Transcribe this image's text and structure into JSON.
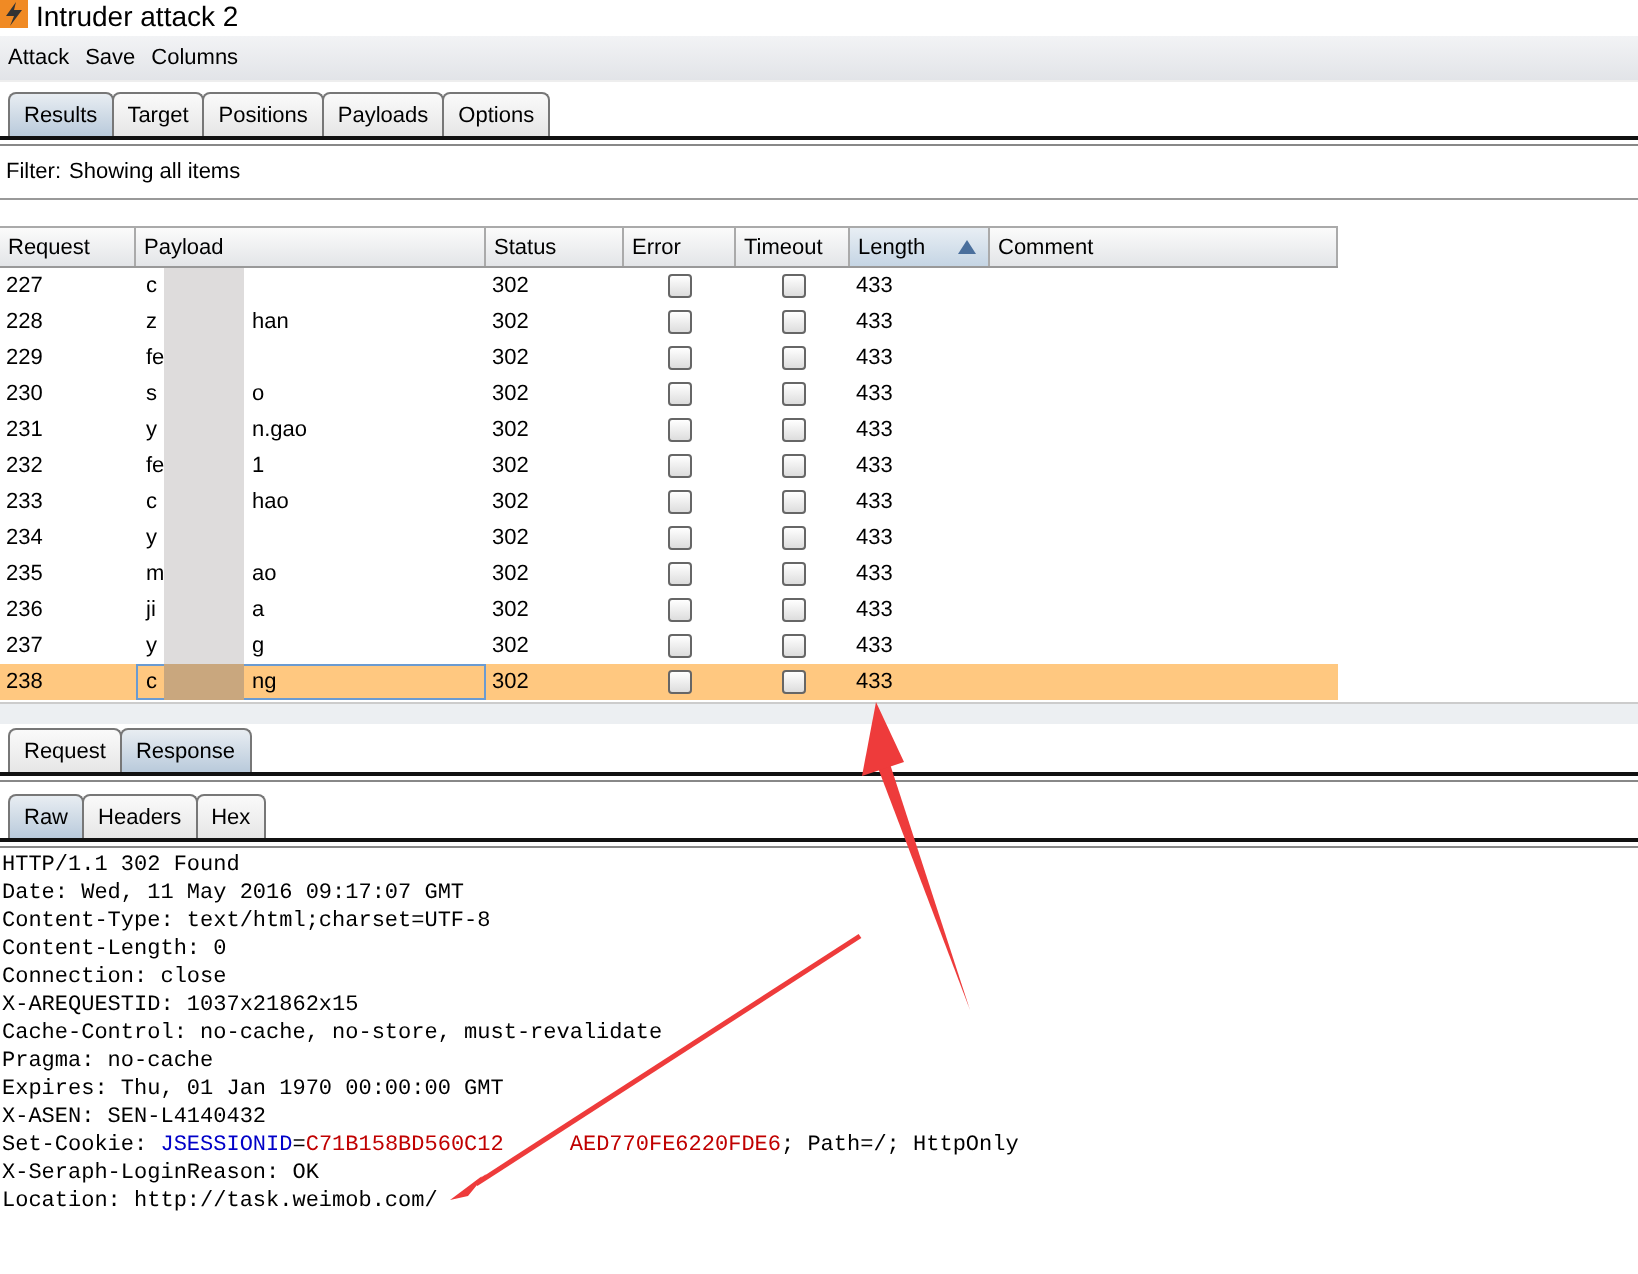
{
  "window": {
    "title": "Intruder attack 2"
  },
  "menu": [
    "Attack",
    "Save",
    "Columns"
  ],
  "tabs": [
    {
      "label": "Results",
      "selected": true
    },
    {
      "label": "Target",
      "selected": false
    },
    {
      "label": "Positions",
      "selected": false
    },
    {
      "label": "Payloads",
      "selected": false
    },
    {
      "label": "Options",
      "selected": false
    }
  ],
  "filter": {
    "label": "Filter:",
    "value": "Showing all items"
  },
  "table": {
    "columns": [
      {
        "label": "Request",
        "sorted": false
      },
      {
        "label": "Payload",
        "sorted": false
      },
      {
        "label": "Status",
        "sorted": false
      },
      {
        "label": "Error",
        "sorted": false
      },
      {
        "label": "Timeout",
        "sorted": false
      },
      {
        "label": "Length",
        "sorted": true
      },
      {
        "label": "Comment",
        "sorted": false
      }
    ],
    "rows": [
      {
        "request": "227",
        "payload_start": "c",
        "status": "302",
        "error": false,
        "timeout": false,
        "length": "433",
        "selected": false
      },
      {
        "request": "228",
        "payload_start": "z",
        "payload_end": "han",
        "status": "302",
        "error": false,
        "timeout": false,
        "length": "433",
        "selected": false
      },
      {
        "request": "229",
        "payload_start": "fe",
        "status": "302",
        "error": false,
        "timeout": false,
        "length": "433",
        "selected": false
      },
      {
        "request": "230",
        "payload_start": "s",
        "payload_end": "o",
        "status": "302",
        "error": false,
        "timeout": false,
        "length": "433",
        "selected": false
      },
      {
        "request": "231",
        "payload_start": "y",
        "payload_end": "n.gao",
        "status": "302",
        "error": false,
        "timeout": false,
        "length": "433",
        "selected": false
      },
      {
        "request": "232",
        "payload_start": "fe",
        "payload_end": "1",
        "status": "302",
        "error": false,
        "timeout": false,
        "length": "433",
        "selected": false
      },
      {
        "request": "233",
        "payload_start": "c",
        "payload_end": "hao",
        "status": "302",
        "error": false,
        "timeout": false,
        "length": "433",
        "selected": false
      },
      {
        "request": "234",
        "payload_start": "y",
        "status": "302",
        "error": false,
        "timeout": false,
        "length": "433",
        "selected": false
      },
      {
        "request": "235",
        "payload_start": "m",
        "payload_end": "ao",
        "status": "302",
        "error": false,
        "timeout": false,
        "length": "433",
        "selected": false
      },
      {
        "request": "236",
        "payload_start": "ji",
        "payload_end": "a",
        "status": "302",
        "error": false,
        "timeout": false,
        "length": "433",
        "selected": false
      },
      {
        "request": "237",
        "payload_start": "y",
        "payload_end": "g",
        "status": "302",
        "error": false,
        "timeout": false,
        "length": "433",
        "selected": false
      },
      {
        "request": "238",
        "payload_start": "c",
        "payload_end": "ng",
        "status": "302",
        "error": false,
        "timeout": false,
        "length": "433",
        "selected": true
      }
    ]
  },
  "message_tabs": [
    {
      "label": "Request",
      "selected": false
    },
    {
      "label": "Response",
      "selected": true
    }
  ],
  "view_tabs": [
    {
      "label": "Raw",
      "selected": true
    },
    {
      "label": "Headers",
      "selected": false
    },
    {
      "label": "Hex",
      "selected": false
    }
  ],
  "response_lines": [
    {
      "segments": [
        {
          "text": "HTTP/1.1 302 Found",
          "color": "#000000"
        }
      ]
    },
    {
      "segments": [
        {
          "text": "Date: Wed, 11 May 2016 09:17:07 GMT",
          "color": "#000000"
        }
      ]
    },
    {
      "segments": [
        {
          "text": "Content-Type: text/html;charset=UTF-8",
          "color": "#000000"
        }
      ]
    },
    {
      "segments": [
        {
          "text": "Content-Length: 0",
          "color": "#000000"
        }
      ]
    },
    {
      "segments": [
        {
          "text": "Connection: close",
          "color": "#000000"
        }
      ]
    },
    {
      "segments": [
        {
          "text": "X-AREQUESTID: 1037x21862x15",
          "color": "#000000"
        }
      ]
    },
    {
      "segments": [
        {
          "text": "Cache-Control: no-cache, no-store, must-revalidate",
          "color": "#000000"
        }
      ]
    },
    {
      "segments": [
        {
          "text": "Pragma: no-cache",
          "color": "#000000"
        }
      ]
    },
    {
      "segments": [
        {
          "text": "Expires: Thu, 01 Jan 1970 00:00:00 GMT",
          "color": "#000000"
        }
      ]
    },
    {
      "segments": [
        {
          "text": "X-ASEN: SEN-L4140432",
          "color": "#000000"
        }
      ]
    },
    {
      "segments": [
        {
          "text": "Set-Cookie: ",
          "color": "#000000"
        },
        {
          "text": "JSESSIONID",
          "color": "#0000c8"
        },
        {
          "text": "=",
          "color": "#000000"
        },
        {
          "text": "C71B158BD560C12",
          "color": "#c00000"
        },
        {
          "text": "AED770FE6220FDE6",
          "color": "#c00000"
        },
        {
          "text": "; Path=/; HttpOnly",
          "color": "#000000"
        }
      ]
    },
    {
      "segments": [
        {
          "text": "X-Seraph-LoginReason: OK",
          "color": "#000000"
        }
      ]
    },
    {
      "segments": [
        {
          "text": "Location: http://task.weimob.com/",
          "color": "#000000"
        }
      ]
    }
  ]
}
